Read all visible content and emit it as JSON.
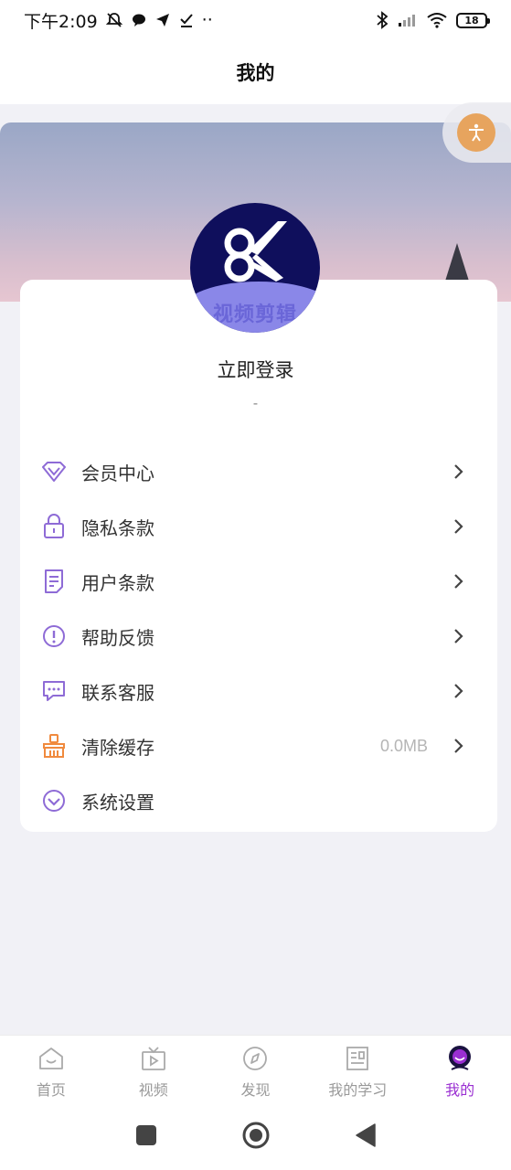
{
  "status_bar": {
    "time": "下午2:09",
    "extra": "··",
    "battery": "18"
  },
  "header": {
    "title": "我的"
  },
  "profile": {
    "avatar_text": "视频剪辑",
    "login_label": "立即登录",
    "sub_label": "-"
  },
  "menu": {
    "items": [
      {
        "label": "会员中心",
        "icon": "diamond-icon",
        "value": ""
      },
      {
        "label": "隐私条款",
        "icon": "lock-icon",
        "value": ""
      },
      {
        "label": "用户条款",
        "icon": "document-icon",
        "value": ""
      },
      {
        "label": "帮助反馈",
        "icon": "exclamation-icon",
        "value": ""
      },
      {
        "label": "联系客服",
        "icon": "chat-icon",
        "value": ""
      },
      {
        "label": "清除缓存",
        "icon": "broom-icon",
        "value": "0.0MB"
      },
      {
        "label": "系统设置",
        "icon": "settings-check-icon",
        "value": ""
      }
    ]
  },
  "tabs": [
    {
      "label": "首页",
      "icon": "home-icon",
      "active": false
    },
    {
      "label": "视频",
      "icon": "tv-icon",
      "active": false
    },
    {
      "label": "发现",
      "icon": "compass-icon",
      "active": false
    },
    {
      "label": "我的学习",
      "icon": "notebook-icon",
      "active": false
    },
    {
      "label": "我的",
      "icon": "profile-icon",
      "active": true
    }
  ],
  "colors": {
    "accent": "#9a2fd2",
    "menu_icon": "#8e6bd6",
    "cache_icon": "#f08a3e",
    "float_button": "#e7a45e"
  }
}
